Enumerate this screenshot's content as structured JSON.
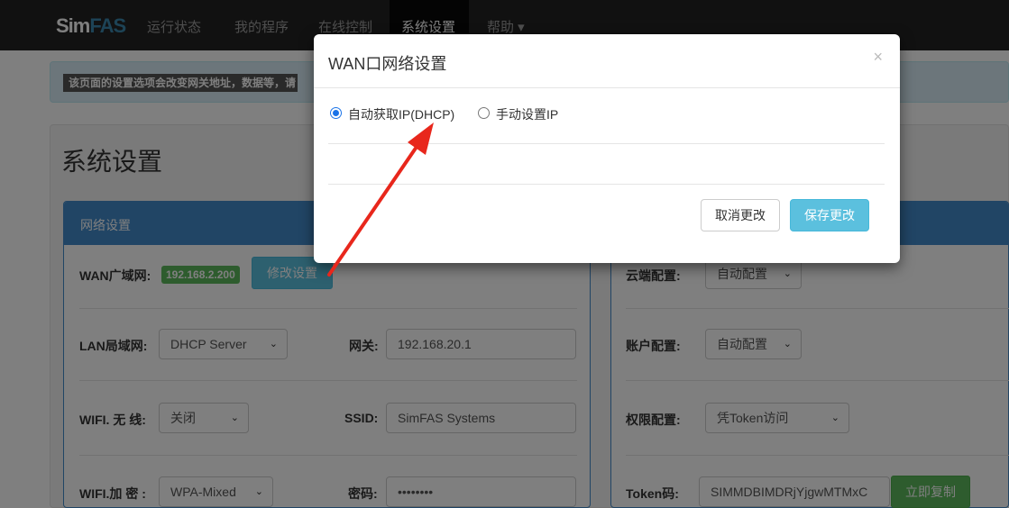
{
  "nav": {
    "brand_a": "Sim",
    "brand_b": "FAS",
    "items": [
      "运行状态",
      "我的程序",
      "在线控制",
      "系统设置",
      "帮助 ▾"
    ]
  },
  "alert": {
    "text": "该页面的设置选项会改变网关地址，数据等，请"
  },
  "page_title": "系统设置",
  "left_panel": {
    "heading": "网络设置",
    "wan_label": "WAN广域网:",
    "wan_ip": "192.168.2.200",
    "modify_button": "修改设置",
    "lan_label": "LAN局域网:",
    "lan_select": "DHCP Server",
    "gateway_label": "网关:",
    "gateway_value": "192.168.20.1",
    "wifi_label": "WIFI. 无 线:",
    "wifi_select": "关闭",
    "ssid_label": "SSID:",
    "ssid_value": "SimFAS Systems",
    "wifi_enc_label": "WIFI.加 密 :",
    "wifi_enc_select": "WPA-Mixed",
    "password_label": "密码:",
    "password_value": "••••••••"
  },
  "right_panel": {
    "cloud_label": "云端配置:",
    "cloud_select": "自动配置",
    "account_label": "账户配置:",
    "account_select": "自动配置",
    "perm_label": "权限配置:",
    "perm_select": "凭Token访问",
    "token_label": "Token码:",
    "token_value": "SIMMDBIMDRjYjgwMTMxC",
    "copy_button": "立即复制"
  },
  "modal": {
    "title": "WAN口网络设置",
    "close": "×",
    "option_dhcp": "自动获取IP(DHCP)",
    "option_manual": "手动设置IP",
    "cancel_button": "取消更改",
    "save_button": "保存更改"
  },
  "colors": {
    "navbar": "#222222",
    "primary": "#428bca",
    "info": "#5bc0de",
    "success": "#5cb85c",
    "arrow": "#e8271c"
  }
}
